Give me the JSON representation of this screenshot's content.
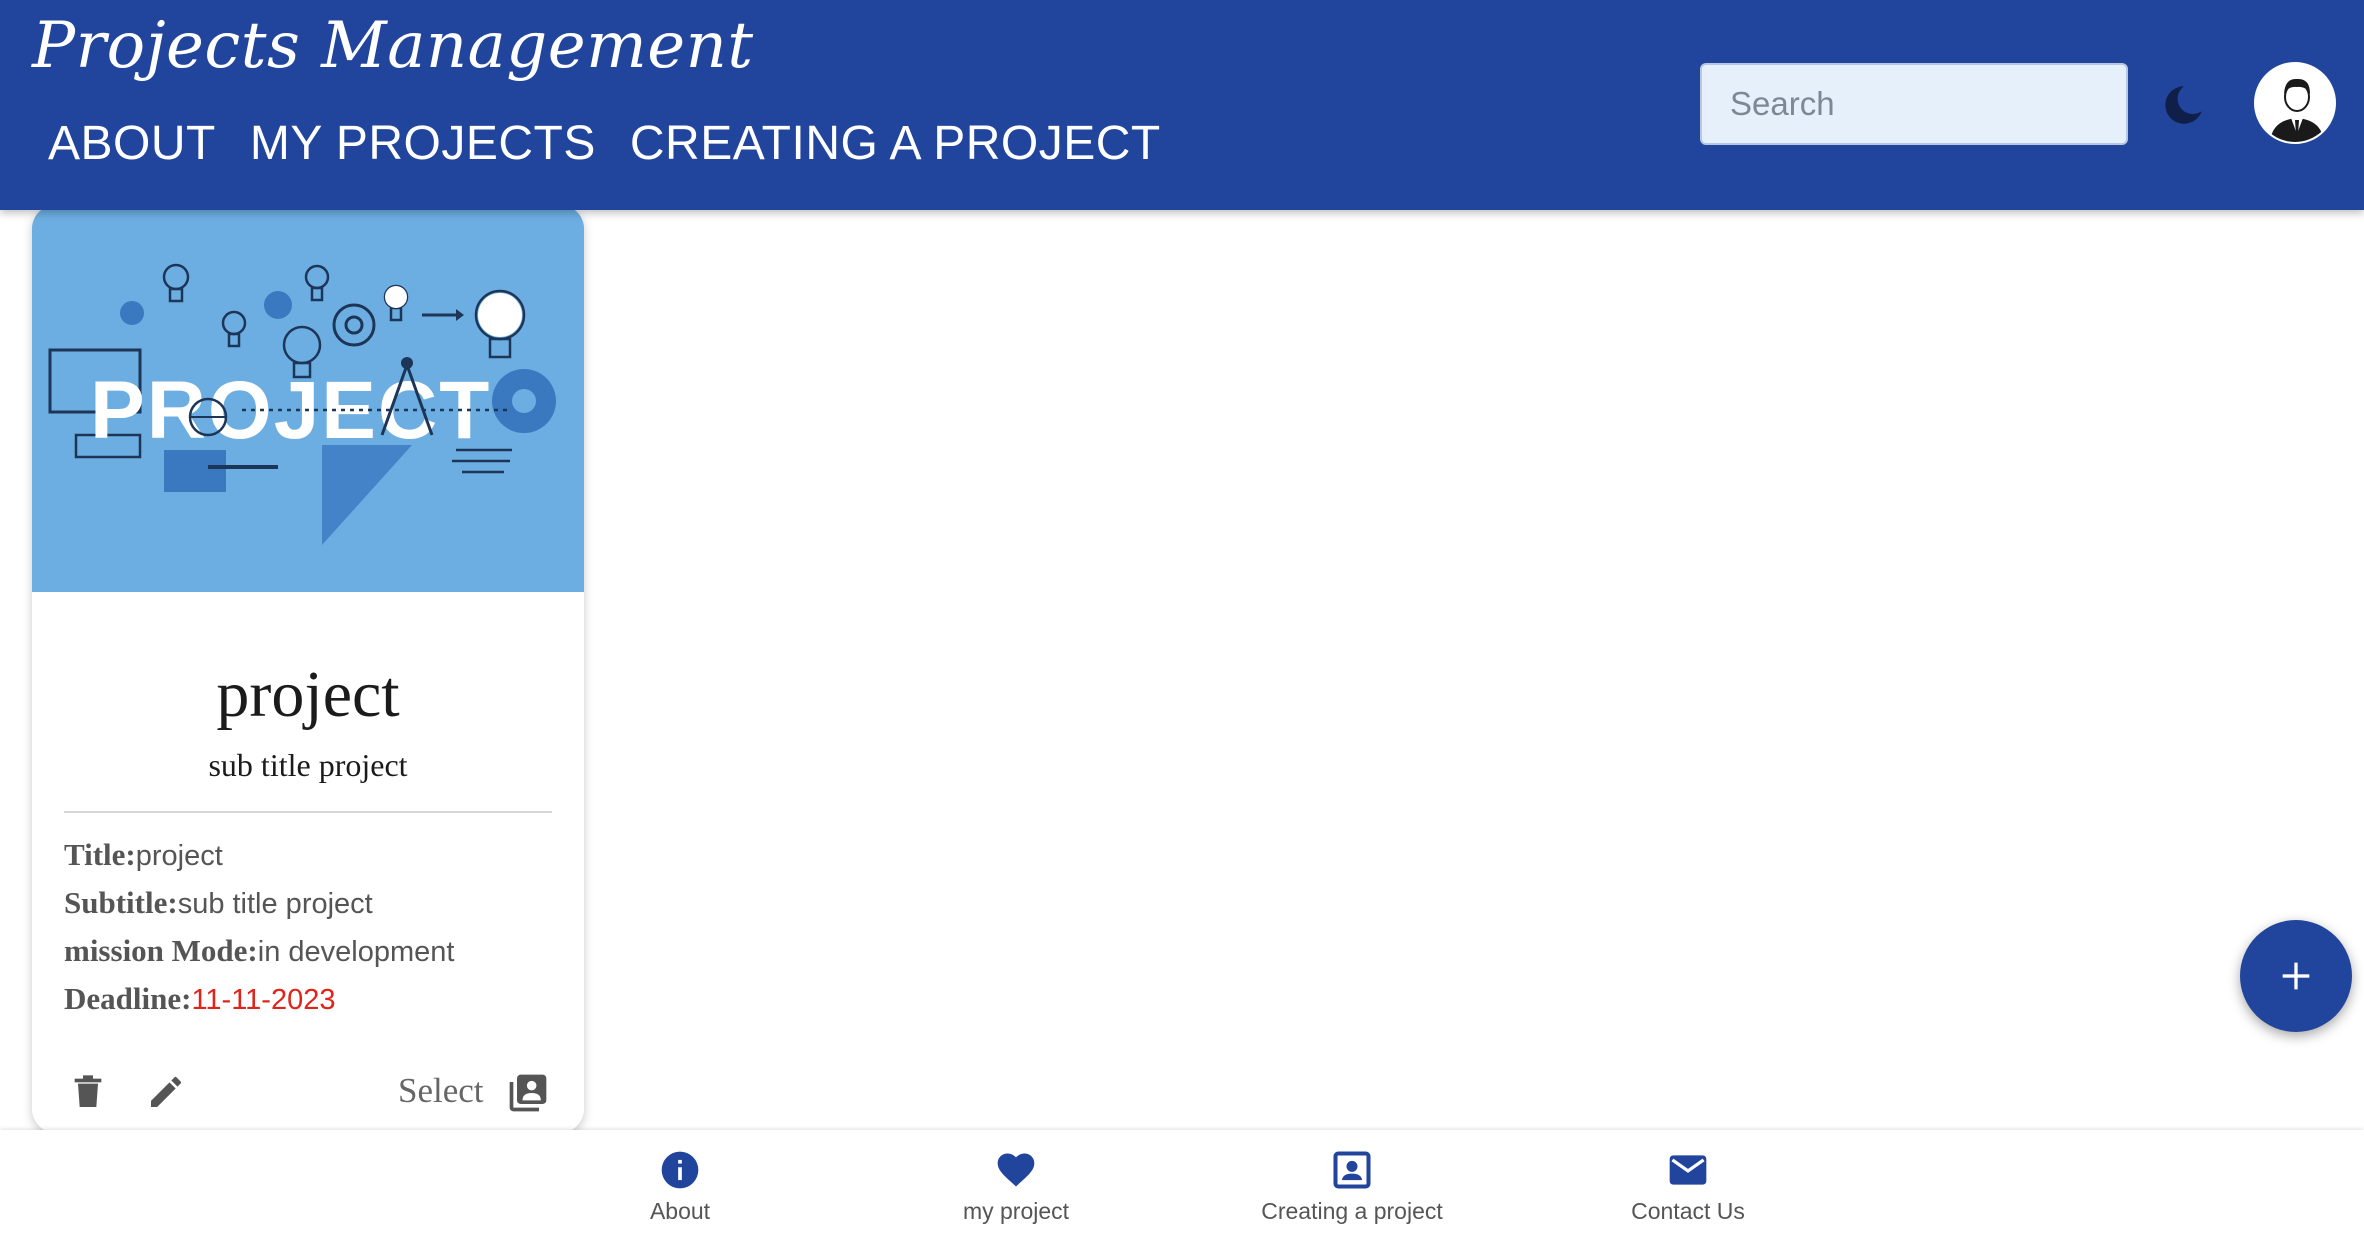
{
  "header": {
    "brand": "Projects Management",
    "nav": [
      "ABOUT",
      "MY PROJECTS",
      "CREATING A PROJECT"
    ],
    "search_placeholder": "Search",
    "search_icon": "search-icon",
    "theme_icon": "moon-icon",
    "avatar_icon": "user-avatar",
    "bg_color": "#21449c"
  },
  "card": {
    "image_text": "PROJECT",
    "title": "project",
    "subtitle": "sub title project",
    "details": [
      {
        "label": "Title:",
        "value": "project"
      },
      {
        "label": "Subtitle:",
        "value": "sub title project"
      },
      {
        "label": "mission Mode:",
        "value": "in development"
      },
      {
        "label": "Deadline:",
        "value": "11-11-2023"
      }
    ],
    "deadline_color": "#e2231a",
    "actions": {
      "delete_icon": "trash-icon",
      "edit_icon": "pencil-icon",
      "select_label": "Select",
      "select_icon": "library-icon"
    }
  },
  "fab": {
    "icon": "plus-icon"
  },
  "bottom_nav": [
    {
      "label": "About",
      "icon": "info-icon"
    },
    {
      "label": "my project",
      "icon": "heart-icon"
    },
    {
      "label": "Creating a project",
      "icon": "contact-card-icon"
    },
    {
      "label": "Contact Us",
      "icon": "mail-icon"
    }
  ]
}
